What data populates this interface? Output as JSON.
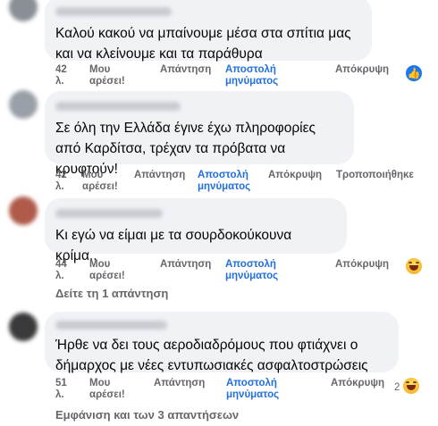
{
  "comments": [
    {
      "text": "Καλού κακού να μπαίνουμε μέσα στα σπίτια μας και να κλείνουμε και τα παράθυρα",
      "time": "42 λ.",
      "like": "Μου αρέσει!",
      "reply": "Απάντηση",
      "message": "Αποστολή μηνύματος",
      "hide": "Απόκρυψη",
      "reaction": "like-icon"
    },
    {
      "text": "Σε όλη την Ελλάδα έγινε έχω πληροφορίες από Καρδίτσα, τρέχαν τα πρόβατα να κρυφτούν!",
      "time": "42 λ.",
      "like": "Μου αρέσει!",
      "reply": "Απάντηση",
      "message": "Αποστολή μηνύματος",
      "hide": "Απόκρυψη",
      "edited": "Τροποποιήθηκε"
    },
    {
      "text": "Κι εγώ να είμαι με τα σουρδοκούκουνα κρίμα..",
      "time": "44 λ.",
      "like": "Μου αρέσει!",
      "reply": "Απάντηση",
      "message": "Αποστολή μηνύματος",
      "hide": "Απόκρυψη",
      "reaction": "haha-icon",
      "see_replies": "Δείτε τη 1 απάντηση"
    },
    {
      "text": "Ήρθε να δει τους αεροδιαδρόμους που φτιάχνει ο δήμαρχος με νέες εντυπωσιακές ασφαλτοστρώσεις",
      "time": "51 λ.",
      "like": "Μου αρέσει!",
      "reply": "Απάντηση",
      "message": "Αποστολή μηνύματος",
      "hide": "Απόκρυψη",
      "reaction": "haha-icon",
      "reaction_count": "2",
      "see_replies": "Εμφάνιση και των 3 απαντήσεων"
    }
  ],
  "colors": {
    "bubble": "#f0f2f5",
    "link": "#216fdb",
    "meta": "#65676b",
    "like": "#1877f2",
    "haha": "#f7b125"
  }
}
